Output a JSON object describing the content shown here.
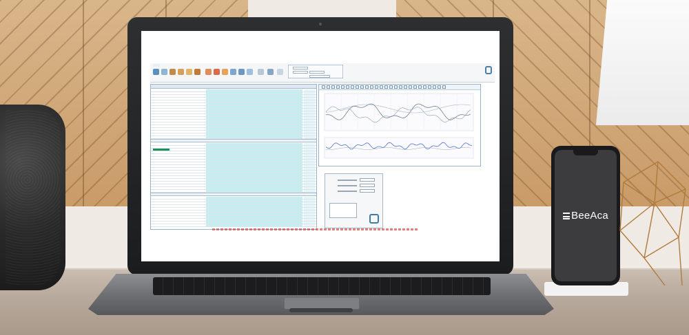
{
  "scene": {
    "phone_brand": "BeeAca"
  },
  "colors": {
    "wood": "#d9b68a",
    "desk": "#b8aa9c",
    "laptop_bezel": "#1b1c1e",
    "app_cell_highlight": "#c4eef0",
    "accent_blue": "#4a7fa8",
    "phone_screen": "#3c3c3e"
  },
  "icons": {
    "brand": "beeaca-logo-icon",
    "app_logo": "app-logo-icon"
  }
}
